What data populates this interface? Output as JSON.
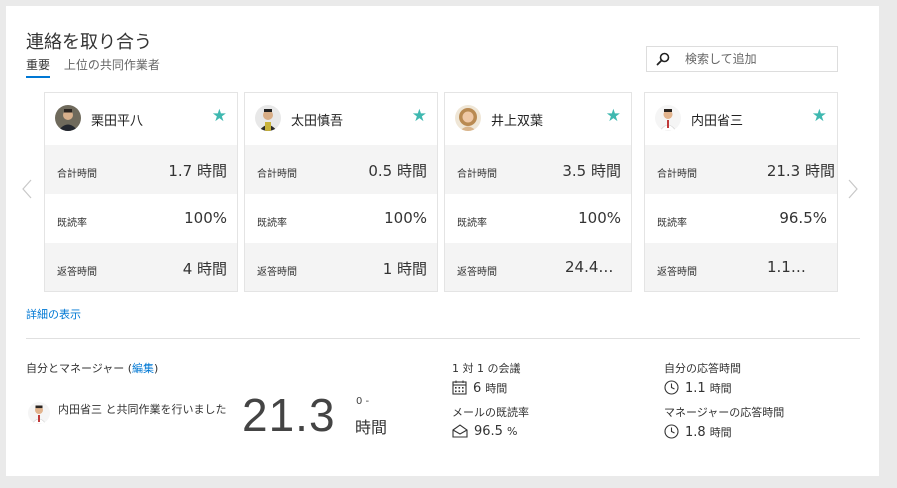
{
  "header": {
    "title": "連絡を取り合う",
    "tabs": [
      {
        "label": "重要",
        "active": true
      },
      {
        "label": "上位の共同作業者",
        "active": false
      }
    ],
    "search_placeholder": "検索して追加"
  },
  "cards": [
    {
      "name": "栗田平八",
      "starred": true,
      "rows": [
        {
          "label": "合計時間",
          "value": "1.7 時間"
        },
        {
          "label": "既読率",
          "value": "100%"
        },
        {
          "label": "返答時間",
          "value": "4 時間"
        }
      ]
    },
    {
      "name": "太田慎吾",
      "starred": true,
      "rows": [
        {
          "label": "合計時間",
          "value": "0.5 時間"
        },
        {
          "label": "既読率",
          "value": "100%"
        },
        {
          "label": "返答時間",
          "value": "1 時間"
        }
      ]
    },
    {
      "name": "井上双葉",
      "starred": true,
      "rows": [
        {
          "label": "合計時間",
          "value": "3.5 時間"
        },
        {
          "label": "既読率",
          "value": "100%"
        },
        {
          "label": "返答時間",
          "value": "24.4…"
        }
      ]
    },
    {
      "name": "内田省三",
      "starred": true,
      "rows": [
        {
          "label": "合計時間",
          "value": "21.3 時間"
        },
        {
          "label": "既読率",
          "value": "96.5%"
        },
        {
          "label": "返答時間",
          "value": "1.1…"
        }
      ]
    }
  ],
  "star_glyph": "★",
  "details_link": "詳細の表示",
  "manager": {
    "title_prefix": "自分とマネージャー (",
    "edit_label": "編集",
    "title_suffix": ")",
    "collab_text": "内田省三 と共同作業を行いました",
    "big_value": "21.3",
    "big_range": "0 -",
    "big_unit": "時間",
    "meetings_label": "1 対 1 の会議",
    "meetings_value": "6",
    "meetings_unit": "時間",
    "mail_read_label": "メールの既読率",
    "mail_read_value": "96.5",
    "mail_read_unit": "%",
    "my_response_label": "自分の応答時間",
    "my_response_value": "1.1",
    "my_response_unit": "時間",
    "mgr_response_label": "マネージャーの応答時間",
    "mgr_response_value": "1.8",
    "mgr_response_unit": "時間"
  },
  "colors": {
    "accent": "#0078d4",
    "star": "#3fb8b0"
  }
}
